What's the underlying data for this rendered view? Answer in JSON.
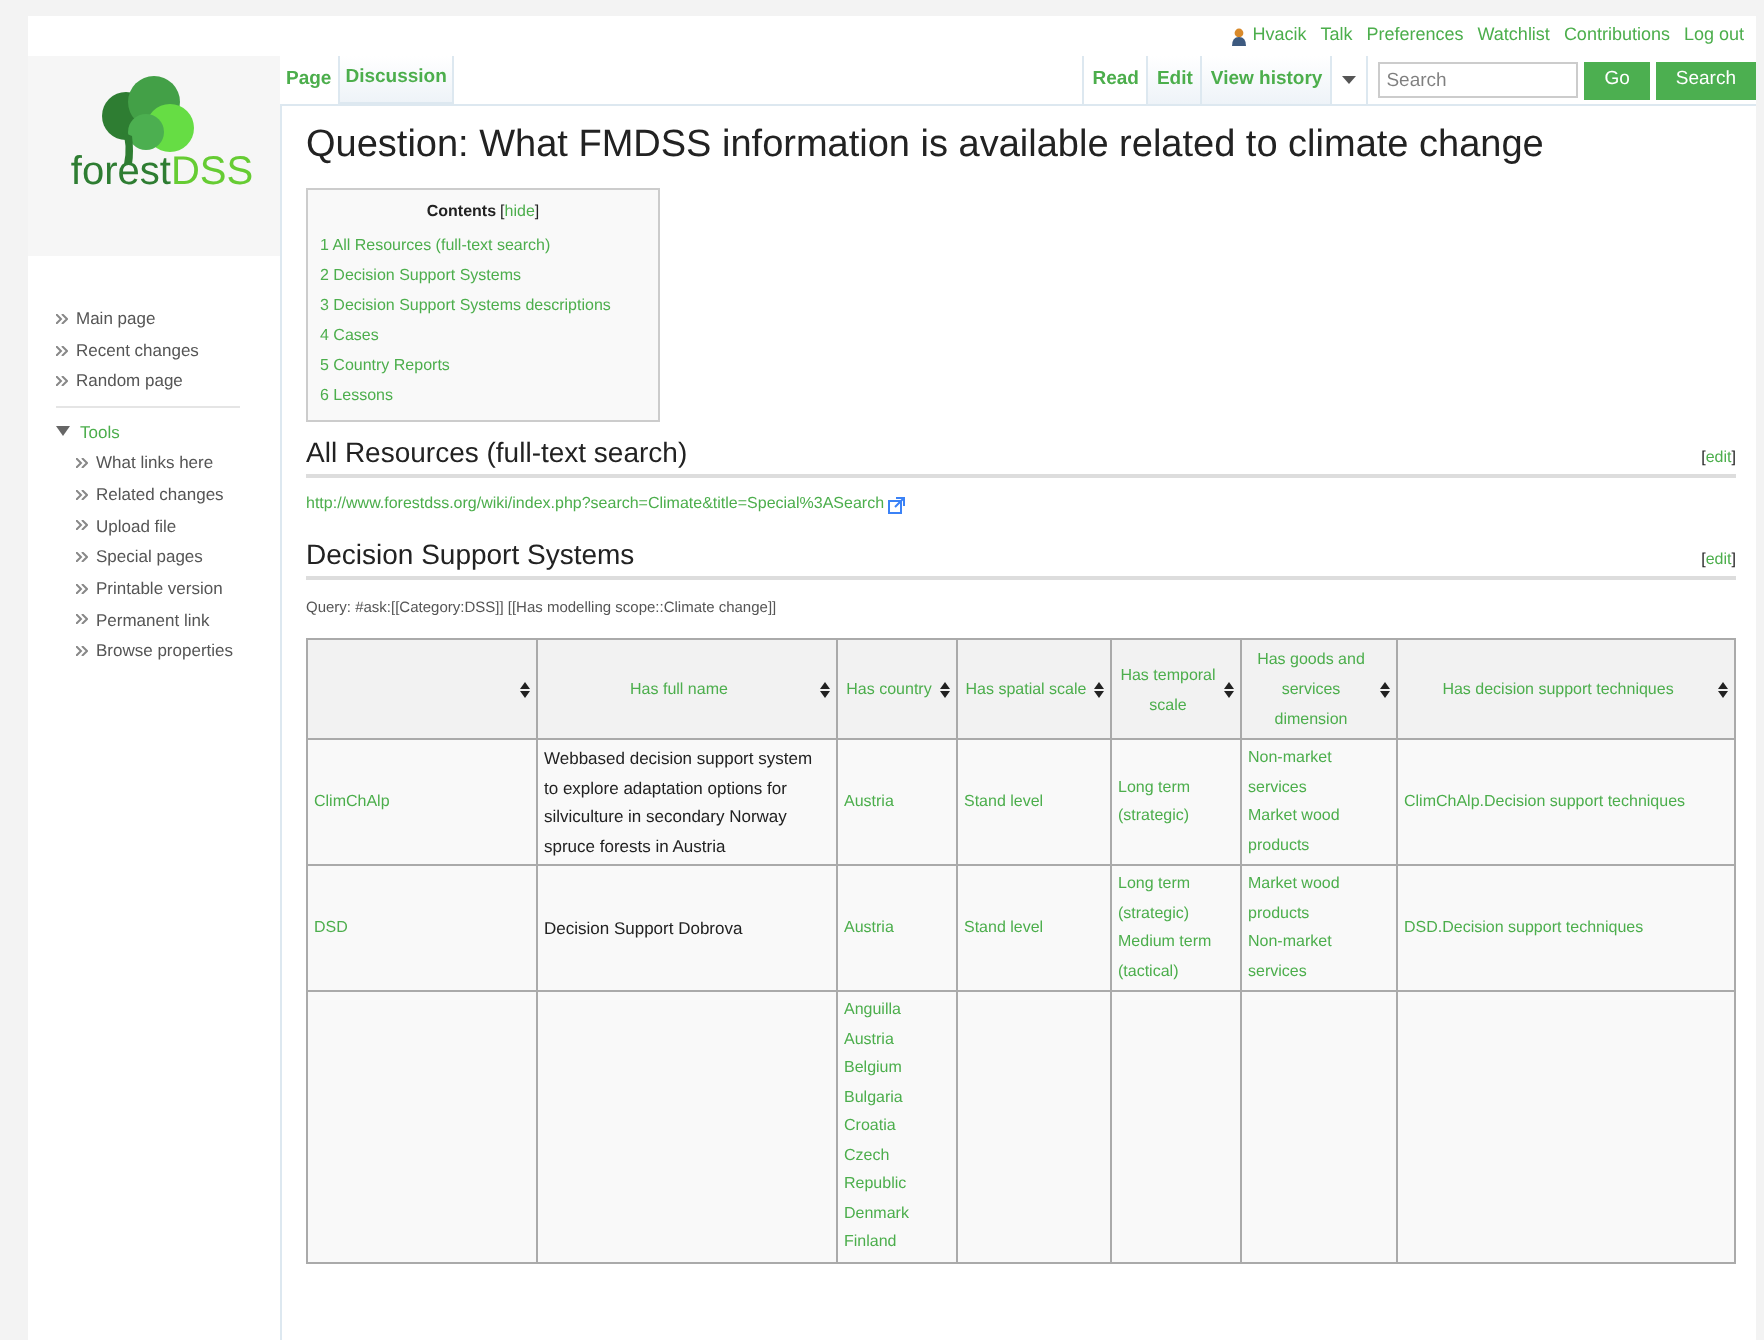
{
  "personal_tools": [
    {
      "label": "Hvacik",
      "kind": "user"
    },
    {
      "label": "Talk",
      "kind": "link"
    },
    {
      "label": "Preferences",
      "kind": "link"
    },
    {
      "label": "Watchlist",
      "kind": "link"
    },
    {
      "label": "Contributions",
      "kind": "link"
    },
    {
      "label": "Log out",
      "kind": "link"
    }
  ],
  "logo": {
    "text_1": "forest",
    "text_2": "DSS"
  },
  "sidebar": {
    "navigation": [
      "Main page",
      "Recent changes",
      "Random page"
    ],
    "tools": {
      "label": "Tools",
      "expanded": true,
      "items": [
        "What links here",
        "Related changes",
        "Upload file",
        "Special pages",
        "Printable version",
        "Permanent link",
        "Browse properties"
      ]
    }
  },
  "namespace_tabs": [
    {
      "label": "Page",
      "selected": true
    },
    {
      "label": "Discussion",
      "selected": false
    }
  ],
  "view_tabs": [
    {
      "label": "Read",
      "selected": true
    },
    {
      "label": "Edit",
      "selected": false
    },
    {
      "label": "View history",
      "selected": false
    }
  ],
  "search": {
    "placeholder": "Search",
    "buttons": [
      "Go",
      "Search"
    ]
  },
  "title": "Question: What FMDSS information is available related to climate change",
  "toc": {
    "title": "Contents",
    "toggle": {
      "open": "[",
      "label": "hide",
      "close": "]"
    },
    "items": [
      {
        "number": "1",
        "label": "All Resources (full-text search)"
      },
      {
        "number": "2",
        "label": "Decision Support Systems"
      },
      {
        "number": "3",
        "label": "Decision Support Systems descriptions"
      },
      {
        "number": "4",
        "label": "Cases"
      },
      {
        "number": "5",
        "label": "Country Reports"
      },
      {
        "number": "6",
        "label": "Lessons"
      }
    ]
  },
  "sections": [
    {
      "heading": "All Resources (full-text search)",
      "edit": {
        "open": "[",
        "label": "edit",
        "close": "]"
      },
      "link": "http://www.forestdss.org/wiki/index.php?search=Climate&title=Special%3ASearch"
    },
    {
      "heading": "Decision Support Systems",
      "edit": {
        "open": "[",
        "label": "edit",
        "close": "]"
      },
      "query": "Query: #ask:[[Category:DSS]] [[Has modelling scope::Climate change]]",
      "table": {
        "columns": [
          {
            "kind": "link"
          },
          {
            "label": "Has full name",
            "kind": "text"
          },
          {
            "label": "Has country",
            "kind": "link"
          },
          {
            "label": "Has spatial scale",
            "kind": "link"
          },
          {
            "label": "Has temporal scale",
            "kind": "link"
          },
          {
            "label": "Has goods and services dimension",
            "kind": "link"
          },
          {
            "label": "Has decision support techniques",
            "kind": "link"
          }
        ],
        "rows": [
          {
            "cells": [
              [
                "ClimChAlp"
              ],
              [
                "Webbased decision support system to explore adaptation options for silviculture in secondary Norway spruce forests in Austria"
              ],
              [
                "Austria"
              ],
              [
                "Stand level"
              ],
              [
                "Long term (strategic)"
              ],
              [
                "Non-market services",
                "Market wood products"
              ],
              [
                "ClimChAlp.Decision support techniques"
              ]
            ]
          },
          {
            "cells": [
              [
                "DSD"
              ],
              [
                "Decision Support Dobrova"
              ],
              [
                "Austria"
              ],
              [
                "Stand level"
              ],
              [
                "Long term (strategic)",
                "Medium term (tactical)"
              ],
              [
                "Market wood products",
                "Non-market services"
              ],
              [
                "DSD.Decision support techniques"
              ]
            ]
          },
          {
            "cells": [
              null,
              null,
              [
                "Anguilla",
                "Austria",
                "Belgium",
                "Bulgaria",
                "Croatia",
                "Czech Republic",
                "Denmark",
                "Finland"
              ],
              null,
              null,
              null,
              null
            ]
          }
        ]
      }
    }
  ]
}
